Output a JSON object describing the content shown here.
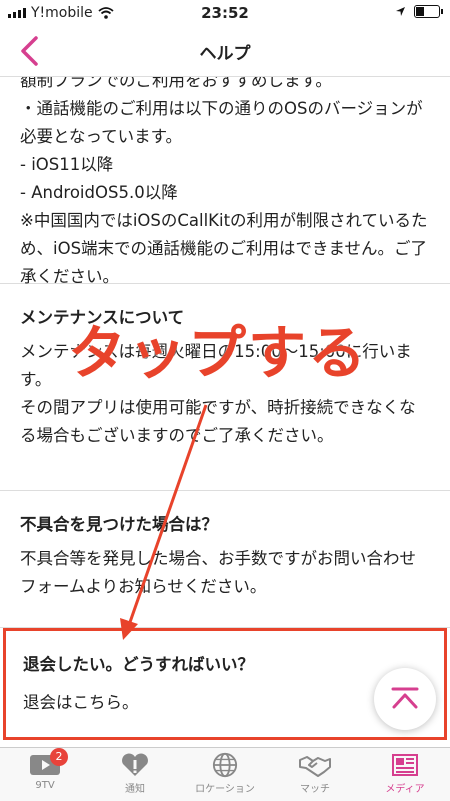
{
  "status": {
    "carrier": "Y!mobile",
    "time": "23:52"
  },
  "nav": {
    "title": "ヘルプ"
  },
  "sections": [
    {
      "question": "",
      "answer": "額制プランでのご利用をおすすめします。\n・通話機能のご利用は以下の通りのOSのバージョンが必要となっています。\n- iOS11以降\n- AndroidOS5.0以降\n※中国国内ではiOSのCallKitの利用が制限されているため、iOS端末での通話機能のご利用はできません。ご了承ください。"
    },
    {
      "question": "メンテナンスについて",
      "answer": "メンテナンスは毎週火曜日の15:00～15:00に行います。\nその間アプリは使用可能ですが、時折接続できなくなる場合もございますのでご了承ください。"
    },
    {
      "question": "不具合を見つけた場合は？",
      "answer": "不具合等を発見した場合、お手数ですがお問い合わせフォームよりお知らせください。"
    },
    {
      "question": "退会したい。どうすればいい？",
      "answer": "退会はこちら。"
    }
  ],
  "annotation": {
    "text": "タップする",
    "color": "#e8432b"
  },
  "tabs": [
    {
      "label": "9TV",
      "icon": "tv-icon",
      "badge": "2"
    },
    {
      "label": "通知",
      "icon": "heart-alert-icon"
    },
    {
      "label": "ロケーション",
      "icon": "globe-icon"
    },
    {
      "label": "マッチ",
      "icon": "handshake-icon"
    },
    {
      "label": "メディア",
      "icon": "newspaper-icon",
      "active": true
    }
  ],
  "colors": {
    "accent": "#d63f8f",
    "highlight": "#e8432b"
  }
}
